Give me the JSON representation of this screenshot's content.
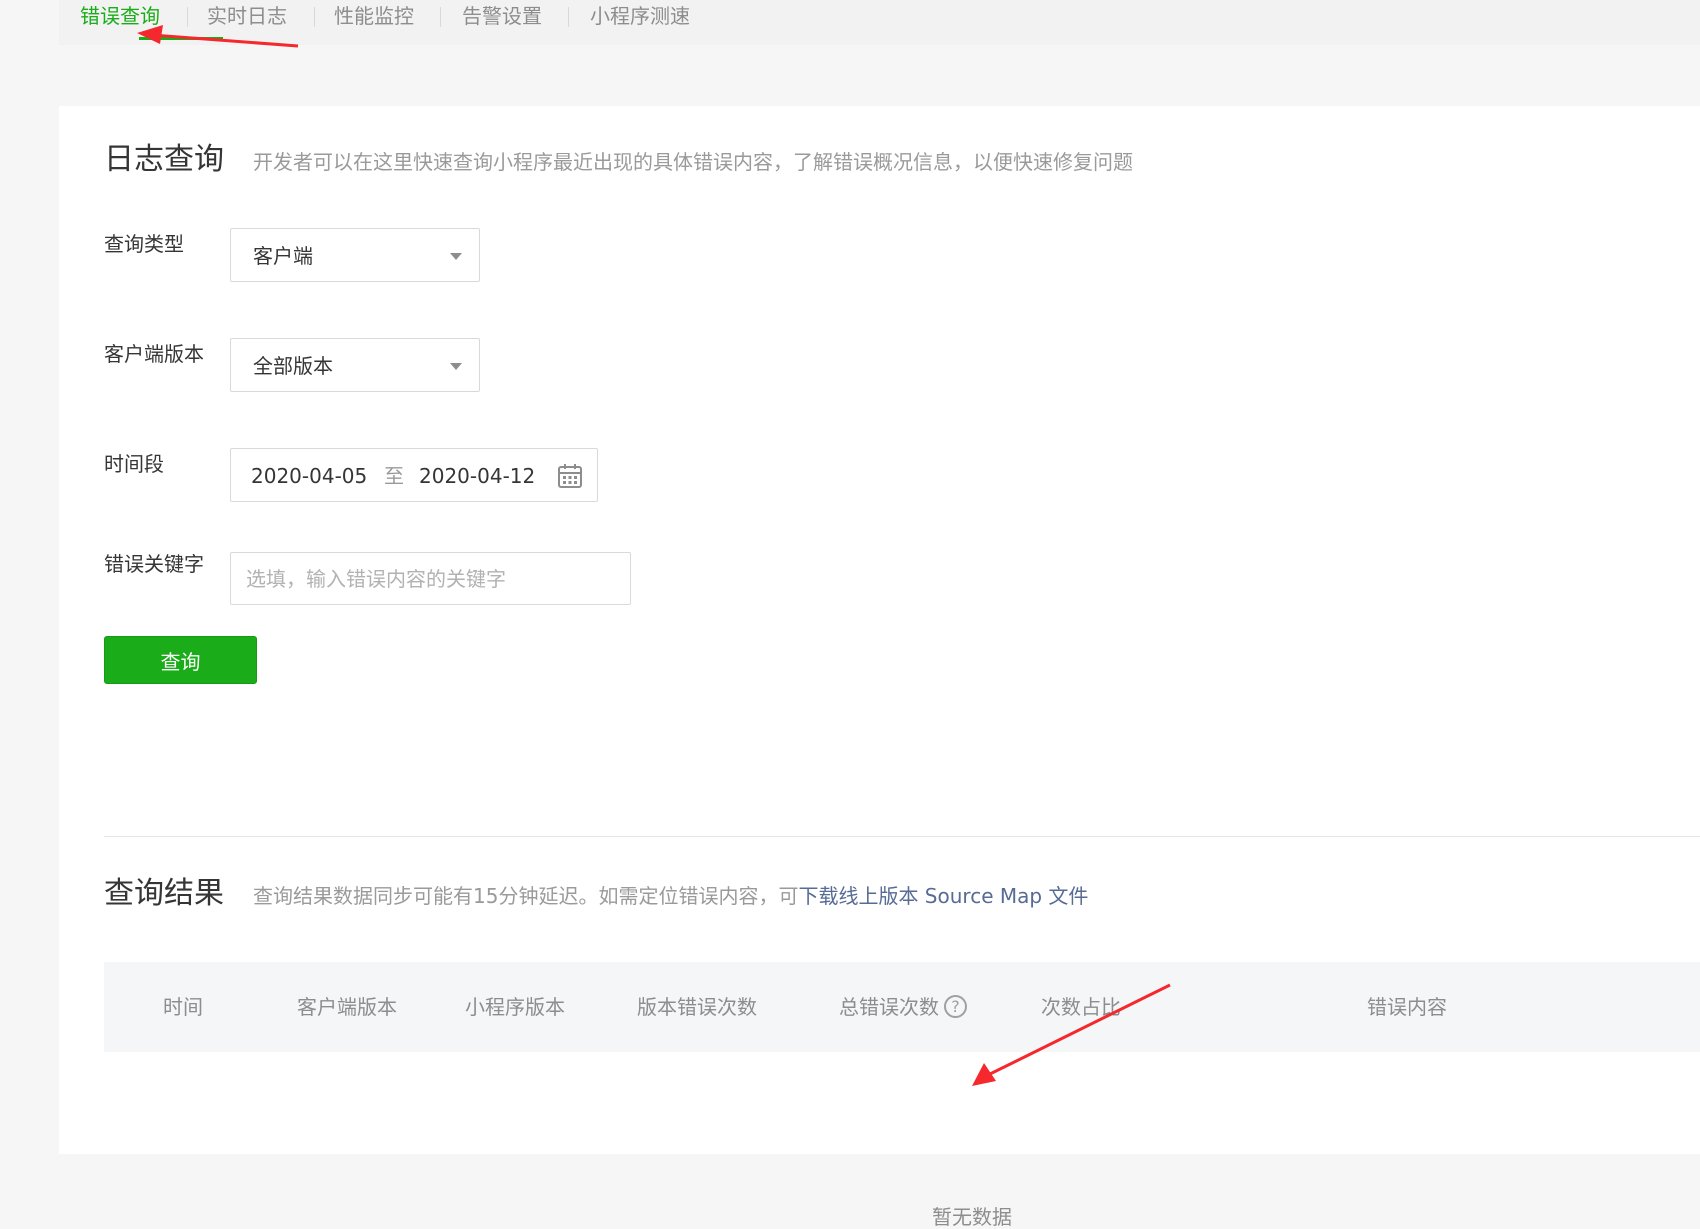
{
  "tabs": [
    {
      "label": "错误查询",
      "active": true
    },
    {
      "label": "实时日志",
      "active": false
    },
    {
      "label": "性能监控",
      "active": false
    },
    {
      "label": "告警设置",
      "active": false
    },
    {
      "label": "小程序测速",
      "active": false
    }
  ],
  "log_query": {
    "title": "日志查询",
    "description": "开发者可以在这里快速查询小程序最近出现的具体错误内容，了解错误概况信息，以便快速修复问题"
  },
  "form": {
    "query_type": {
      "label": "查询类型",
      "value": "客户端"
    },
    "client_version": {
      "label": "客户端版本",
      "value": "全部版本"
    },
    "time_range": {
      "label": "时间段",
      "start": "2020-04-05",
      "separator": "至",
      "end": "2020-04-12"
    },
    "keyword": {
      "label": "错误关键字",
      "placeholder": "选填，输入错误内容的关键字"
    },
    "submit_label": "查询"
  },
  "results": {
    "title": "查询结果",
    "description": "查询结果数据同步可能有15分钟延迟。如需定位错误内容，可",
    "link_text": "下载线上版本 Source Map 文件",
    "columns": [
      "时间",
      "客户端版本",
      "小程序版本",
      "版本错误次数",
      "总错误次数",
      "次数占比",
      "错误内容"
    ],
    "help_glyph": "?",
    "empty_text": "暂无数据"
  },
  "colors": {
    "accent": "#1aad19",
    "link": "#576b95",
    "annotation_arrow": "#f5282d"
  },
  "icons": {
    "dropdown": "caret-down-icon",
    "calendar": "calendar-icon",
    "help": "question-circle-icon"
  }
}
